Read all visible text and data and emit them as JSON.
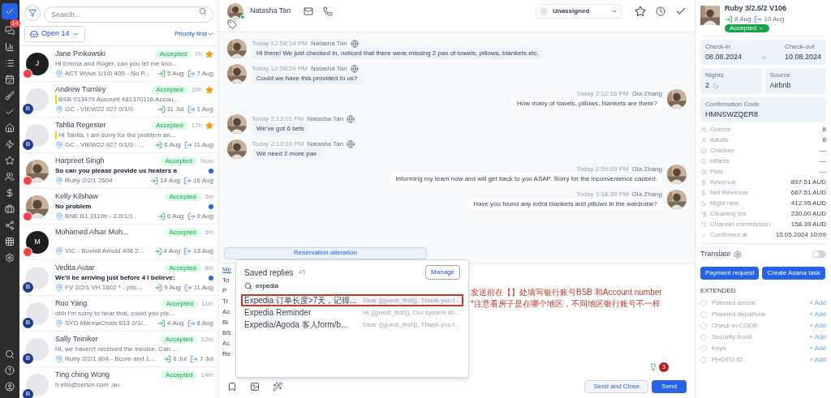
{
  "rail": {
    "messages_badge": "14"
  },
  "inbox": {
    "search": {
      "placeholder": "Search..."
    },
    "status_filter": "Open",
    "status_count": "14",
    "sort": "Priority first",
    "conversations": [
      {
        "name": "Jane Pinkowski",
        "status": "Accepted",
        "time": "7h",
        "starred": true,
        "preview": {
          "text": "Hi Emma and Roger, can you let me kno...",
          "kind": "plain"
        },
        "unread": false,
        "location": "ACT Wove 1/1/0 405 - No P...",
        "check_in": "5 Aug",
        "check_out": "7 Aug",
        "avatar": {
          "kind": "initial",
          "text": "J"
        },
        "badge": {
          "kind": "red"
        }
      },
      {
        "name": "Andrew Turnley",
        "status": "Accepted",
        "time": "19h",
        "starred": true,
        "preview": {
          "text": "BSB 013479 Account 481370116 Accou...",
          "kind": "note"
        },
        "unread": false,
        "location": "GC - VIEW22 927 0/1/0",
        "check_in": "11 Jul",
        "check_out": "1 Aug",
        "avatar": {
          "kind": "placeholder"
        },
        "badge": {
          "kind": "letter",
          "text": "B"
        }
      },
      {
        "name": "Tahlia Regester",
        "status": "Accepted",
        "time": "17h",
        "starred": true,
        "preview": {
          "text": "Hi Tahlia, I am sorry for the problem an...",
          "kind": "note"
        },
        "unread": false,
        "location": "GC - VIEW22 927 0/1/0 - ...",
        "check_in": "6 Aug",
        "check_out": "11 Aug",
        "avatar": {
          "kind": "placeholder"
        },
        "badge": {
          "kind": "letter",
          "text": "B"
        }
      },
      {
        "name": "Harpreet Singh",
        "status": "Accepted",
        "time": "Now",
        "starred": false,
        "preview": {
          "text": "So can you please provide us heaters a",
          "kind": "bold"
        },
        "unread": true,
        "location": "Ruby 2/2/1 2604",
        "check_in": "14 Aug",
        "check_out": "16 Aug",
        "badge": {
          "kind": "red"
        }
      },
      {
        "name": "Kelly Kilshaw",
        "status": "Accepted",
        "time": "3m",
        "starred": false,
        "preview": {
          "text": "No problem",
          "kind": "bold"
        },
        "unread": true,
        "location": "BNE B1 3110b - 2.0/1/1",
        "check_in": "6 Aug",
        "check_out": "9 Aug",
        "badge": {
          "kind": "red"
        }
      },
      {
        "name": "Mohamed Afsar Moh...",
        "status": "Accepted",
        "time": "3m",
        "starred": false,
        "unread": false,
        "location": "VIC - Boxhill Amold 408 2...",
        "check_in": "4 Aug",
        "check_out": "13 Aug",
        "avatar": {
          "kind": "initial",
          "text": "M"
        },
        "badge": {
          "kind": "red"
        }
      },
      {
        "name": "Vedita Autar",
        "status": "Accepted",
        "time": "8m",
        "starred": false,
        "preview": {
          "text": "We'll be arriving just before 4 I believe:",
          "kind": "bold"
        },
        "unread": true,
        "location": "FV 2/2/1 VH 1602 * - pric...",
        "check_in": "9 Aug",
        "check_out": "11 Aug",
        "avatar": {
          "kind": "placeholder"
        },
        "badge": {
          "kind": "letter",
          "text": "B"
        }
      },
      {
        "name": "Ruo Yang",
        "status": "Accepted",
        "time": "11m",
        "starred": false,
        "preview": {
          "text": "ohh I'm sorry to hear that, could you ple...",
          "kind": "plain"
        },
        "unread": false,
        "location": "SYD MarmaChats 813 0/1/...",
        "check_in": "4 Aug",
        "check_out": "8 Aug",
        "avatar": {
          "kind": "placeholder"
        },
        "badge": {
          "kind": "letter",
          "text": "B"
        }
      },
      {
        "name": "Sally Teiniker",
        "status": "Accepted",
        "time": "12m",
        "starred": false,
        "preview": {
          "text": "Hi, we haven't received the invoice. Can ...",
          "kind": "plain"
        },
        "unread": false,
        "location": "Ruby 2/2/1 804 - Bcom and 1...",
        "check_in": "6 Jul",
        "check_out": "7 Jul",
        "avatar": {
          "kind": "placeholder"
        },
        "badge": {
          "kind": "letter",
          "text": "B"
        }
      },
      {
        "name": "Ting ching Wong",
        "status": "Accepted",
        "time": "14m",
        "starred": false,
        "preview": {
          "text": "h ello@sersin.com .au",
          "kind": "plain"
        },
        "unread": false,
        "avatar": {
          "kind": "placeholder"
        },
        "badge": {
          "kind": "letter",
          "text": "B"
        }
      }
    ]
  },
  "chat": {
    "contact": "Natasha Tan",
    "assignee": "Unassigned",
    "messages": [
      {
        "kind": "incoming",
        "time": "Today 12:58:14 PM",
        "sender": "Natasha Tan",
        "text": "Hi there! We just checked in, noticed that there were missing 2 pax of towels, pillows, blankets etc."
      },
      {
        "kind": "incoming",
        "time": "Today 12:58:24 PM",
        "sender": "Natasha Tan",
        "text": "Could we have this provided to us?"
      },
      {
        "kind": "outgoing",
        "time": "Today 2:12:16 PM",
        "sender": "Gia Zhang",
        "text": "How many of towels, pillows, blankets are there?"
      },
      {
        "kind": "incoming",
        "time": "Today 2:13:01 PM",
        "sender": "Natasha Tan",
        "text": "We've got 6 sets"
      },
      {
        "kind": "incoming",
        "time": "Today 2:13:10 PM",
        "sender": "Natasha Tan",
        "text": "We need 2 more pax"
      },
      {
        "kind": "outgoing",
        "time": "Today 2:59:09 PM",
        "sender": "Gia Zhang",
        "text": "Informing my team now and will get back to you ASAP. Sorry for the inconvenience caused."
      },
      {
        "kind": "outgoing",
        "time": "Today 3:18:39 PM",
        "sender": "Gia Zhang",
        "text": "Have you found any extra blankets and pillows in the wardrobe?"
      }
    ],
    "banner": "Reservation alteration",
    "composer": {
      "tab_fragment": "Me",
      "fragments": [
        "To",
        "P",
        "Tr",
        "Ac",
        "Bi",
        "BS",
        "Ac",
        "Re"
      ],
      "suggestion_count": "3"
    },
    "saved_replies": {
      "title": "Saved replies",
      "count": "45",
      "manage": "Manage",
      "query": "expedia",
      "items": [
        {
          "title": "Expedia 订单长度>7天，记得...",
          "preview": "Dear {{guest_first}}, Thank you f...",
          "selected": true
        },
        {
          "title": "Expedia Reminder",
          "preview": "Hi {{guest_first}}, Our system sh...",
          "selected": false
        },
        {
          "title": "Expedia/Agoda 客人form/b...",
          "preview": "Dear {{guest_first}}, Thank you f...",
          "selected": false
        }
      ]
    },
    "annotation": [
      "发送前在【】处填写银行账号BSB 和Account number",
      "*注意看房子是在哪个地区，不同地区银行账号不一样"
    ],
    "buttons": {
      "send_close": "Send and Close",
      "send": "Send"
    }
  },
  "reservation": {
    "property": "Ruby 3/2.5/2 V106",
    "check_in_short": "8 Aug",
    "check_out_short": "10 Aug",
    "status": "Accepted",
    "check_in": {
      "label": "Check-in",
      "value": "08.08.2024"
    },
    "check_out": {
      "label": "Check-out",
      "value": "10.08.2024"
    },
    "nights": {
      "label": "Nights",
      "value": "2"
    },
    "source": {
      "label": "Source",
      "value": "Airbnb"
    },
    "confirmation": {
      "label": "Confirmation Code",
      "value": "HMNSWZQER8"
    },
    "details": [
      {
        "label": "Guests",
        "value": "8"
      },
      {
        "label": "Adults",
        "value": "8"
      },
      {
        "label": "Children",
        "value": "—"
      },
      {
        "label": "Infants",
        "value": "—"
      },
      {
        "label": "Pets",
        "value": "—"
      },
      {
        "label": "Revenue",
        "value": "897.51 AUD"
      },
      {
        "label": "Net Revenue",
        "value": "667.51 AUD"
      },
      {
        "label": "Night rate",
        "value": "412.95 AUD"
      },
      {
        "label": "Cleaning fee",
        "value": "230.00 AUD"
      },
      {
        "label": "Channel commission",
        "value": "158.39 AUD"
      },
      {
        "label": "Confirmed at",
        "value": "15.05.2024 10:09"
      }
    ],
    "translate": {
      "label": "Translate",
      "on": false
    },
    "actions": [
      "Payment request",
      "Create Asana task"
    ],
    "extended": {
      "title": "EXTENDED",
      "items": [
        {
          "label": "Planned arrival",
          "action": "+ Add"
        },
        {
          "label": "Planned departure",
          "action": "+ Add"
        },
        {
          "label": "Check in CODE",
          "action": "+ Add"
        },
        {
          "label": "Security Bond",
          "action": "+ Add"
        },
        {
          "label": "Keys",
          "action": "+ Add"
        },
        {
          "label": "PHOTO ID",
          "action": "+ Add"
        }
      ]
    }
  }
}
